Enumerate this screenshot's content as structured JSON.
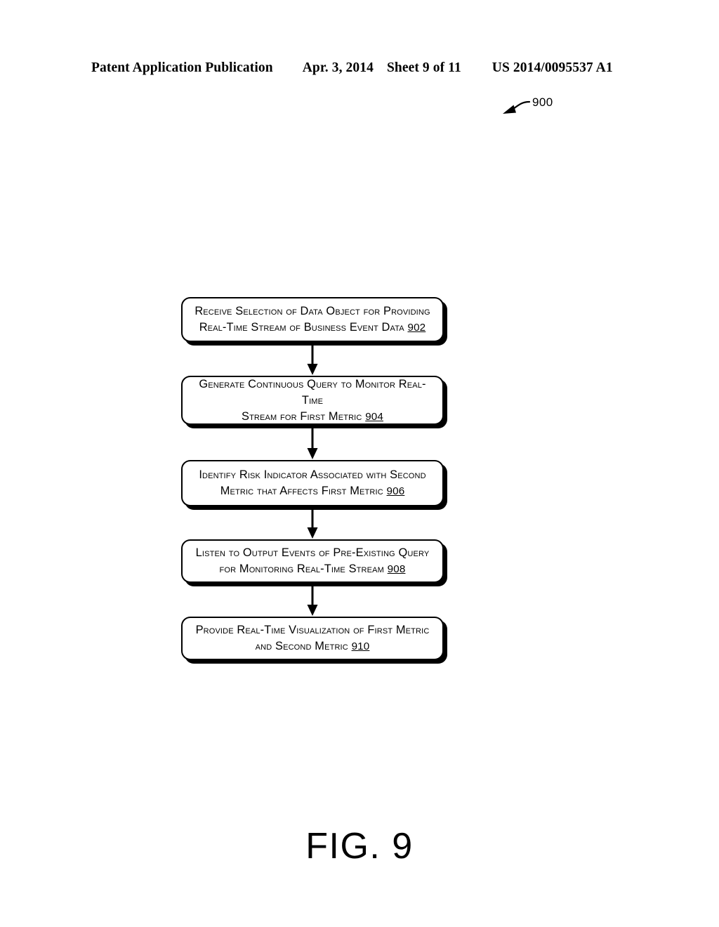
{
  "header": {
    "publication": "Patent Application Publication",
    "date": "Apr. 3, 2014",
    "sheet": "Sheet 9 of 11",
    "serial": "US 2014/0095537 A1"
  },
  "callout": {
    "reference_number": "900"
  },
  "figure": {
    "caption": "FIG. 9"
  },
  "flowchart": {
    "steps": [
      {
        "line1": "Receive Selection of Data Object for Providing",
        "line2": "Real-Time Stream of Business Event Data",
        "ref": "902"
      },
      {
        "line1": "Generate Continuous Query to Monitor Real-Time",
        "line2": "Stream for First Metric",
        "ref": "904"
      },
      {
        "line1": "Identify Risk Indicator Associated with Second",
        "line2": "Metric that Affects First Metric",
        "ref": "906"
      },
      {
        "line1": "Listen to Output Events of Pre-Existing Query",
        "line2": "for Monitoring Real-Time Stream",
        "ref": "908"
      },
      {
        "line1": "Provide Real-Time Visualization of First Metric",
        "line2": "and Second Metric",
        "ref": "910"
      }
    ]
  }
}
